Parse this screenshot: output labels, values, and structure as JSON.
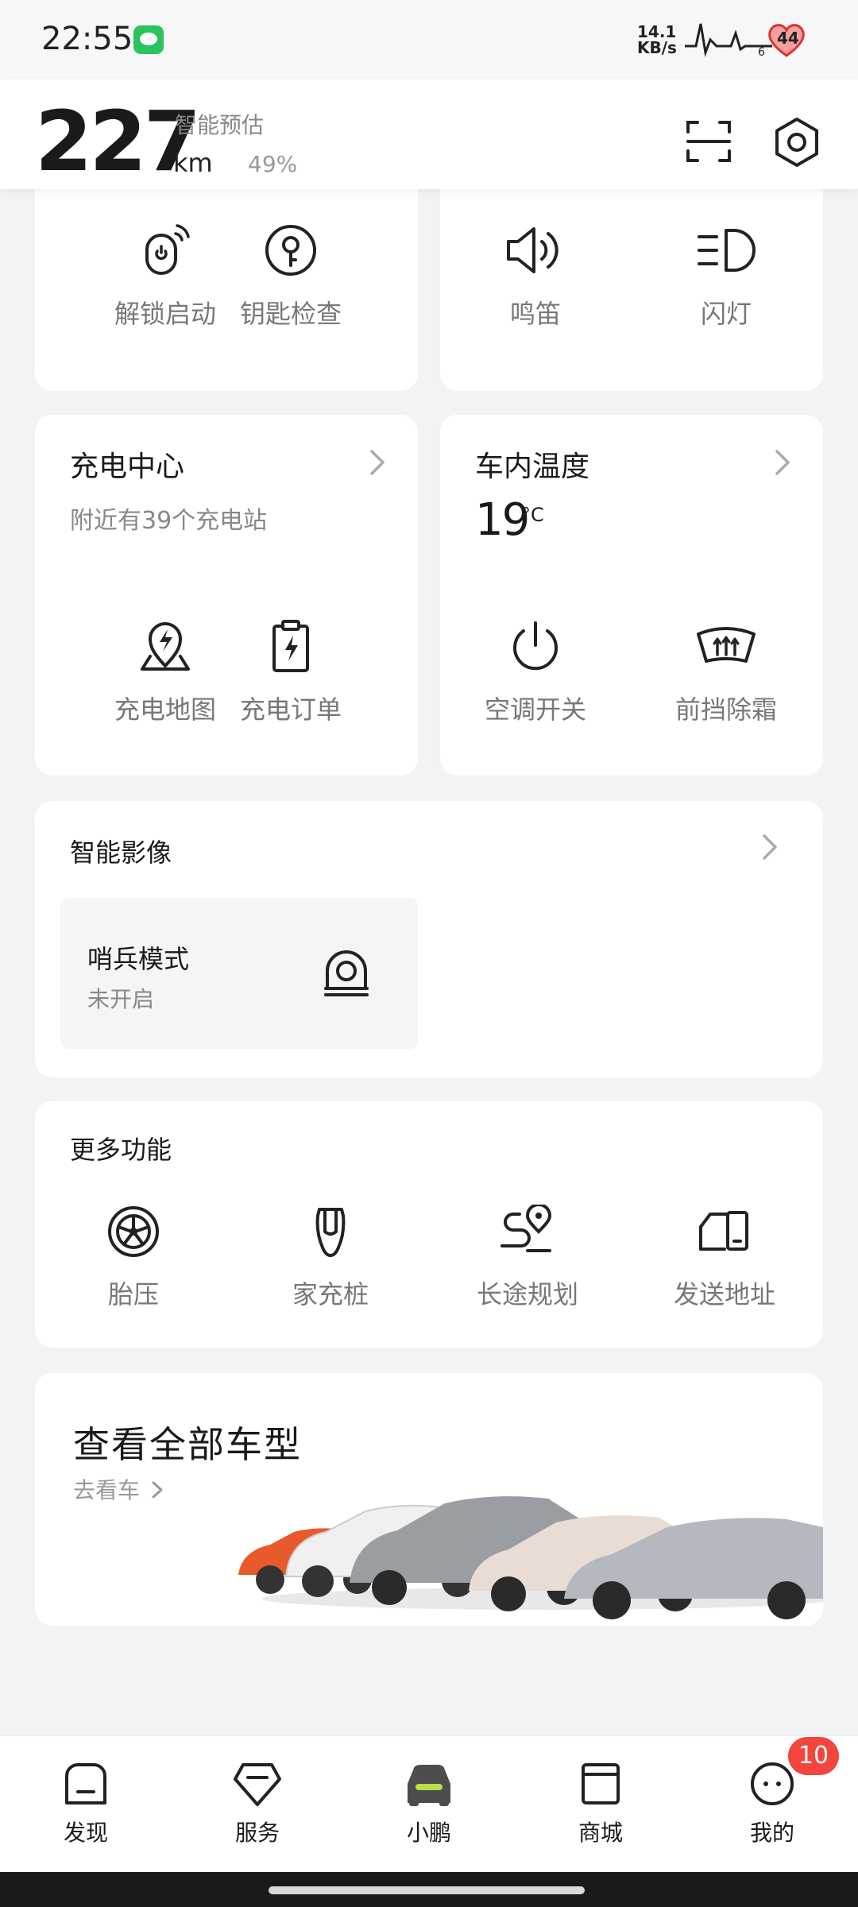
{
  "status_bar": {
    "time": "22:55",
    "net_speed_value": "14.1",
    "net_speed_unit": "KB/s",
    "pulse_number": "6",
    "heart_number": "44"
  },
  "header": {
    "range_value": "227",
    "range_label": "智能预估",
    "range_unit": "km",
    "battery_percent": "49%"
  },
  "quick_controls": {
    "items": [
      {
        "label": "解锁启动",
        "icon": "remote-unlock-icon"
      },
      {
        "label": "钥匙检查",
        "icon": "key-icon"
      },
      {
        "label": "鸣笛",
        "icon": "horn-icon"
      },
      {
        "label": "闪灯",
        "icon": "headlight-icon"
      }
    ]
  },
  "charging": {
    "title": "充电中心",
    "subtitle": "附近有39个充电站",
    "items": [
      {
        "label": "充电地图",
        "icon": "charging-map-icon"
      },
      {
        "label": "充电订单",
        "icon": "charging-order-icon"
      }
    ]
  },
  "climate": {
    "title": "车内温度",
    "temperature": "19",
    "unit": "°C",
    "items": [
      {
        "label": "空调开关",
        "icon": "power-icon"
      },
      {
        "label": "前挡除霜",
        "icon": "windshield-defrost-icon"
      }
    ]
  },
  "smart_camera": {
    "title": "智能影像",
    "sentry_title": "哨兵模式",
    "sentry_status": "未开启"
  },
  "more_features": {
    "title": "更多功能",
    "items": [
      {
        "label": "胎压",
        "icon": "tire-icon"
      },
      {
        "label": "家充桩",
        "icon": "home-charger-icon"
      },
      {
        "label": "长途规划",
        "icon": "route-planning-icon"
      },
      {
        "label": "发送地址",
        "icon": "send-address-icon"
      }
    ]
  },
  "models": {
    "title": "查看全部车型",
    "link": "去看车"
  },
  "bottom_nav": {
    "items": [
      {
        "label": "发现",
        "icon": "discover-icon"
      },
      {
        "label": "服务",
        "icon": "service-icon"
      },
      {
        "label": "小鹏",
        "icon": "car-icon"
      },
      {
        "label": "商城",
        "icon": "shop-icon"
      },
      {
        "label": "我的",
        "icon": "profile-icon"
      }
    ],
    "badge": "10"
  },
  "colors": {
    "accent": "#b7e04a",
    "badge": "#f2453d",
    "card": "#ffffff",
    "background": "#f2f3f5"
  }
}
